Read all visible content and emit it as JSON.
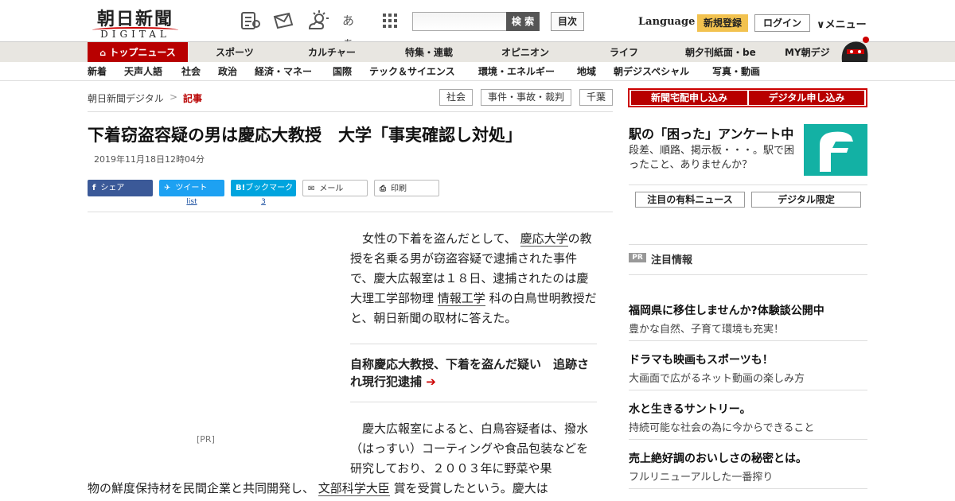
{
  "header": {
    "logo_kanji": "朝日新聞",
    "logo_sub": "DIGITAL",
    "search_button": "検 索",
    "search_placeholder": "",
    "toc_button": "目次",
    "language": "Language",
    "signup": "新規登録",
    "login": "ログイン",
    "menu": "メニュー",
    "icons": [
      "news-list-icon",
      "mail-icon",
      "weather-icon",
      "font-size-icon",
      "grid-menu-icon"
    ],
    "font_icon_text": "あぁ"
  },
  "nav_main": [
    "トップニュース",
    "スポーツ",
    "カルチャー",
    "特集・連載",
    "オピニオン",
    "ライフ",
    "朝夕刊紙面・be",
    "MY朝デジ"
  ],
  "nav_sub": [
    "新着",
    "天声人語",
    "社会",
    "政治",
    "経済・マネー",
    "国際",
    "テック＆サイエンス",
    "環境・エネルギー",
    "地域",
    "朝デジスペシャル",
    "写真・動画"
  ],
  "breadcrumb": {
    "home": "朝日新聞デジタル",
    "sep": ">",
    "current": "記事"
  },
  "tags": [
    "社会",
    "事件・事故・裁判",
    "千葉"
  ],
  "article": {
    "title": "下着窃盗容疑の男は慶応大教授　大学「事実確認し対処」",
    "date": "2019年11月18日12時04分",
    "share": {
      "facebook": "シェア",
      "twitter": "ツイート",
      "twitter_count": "list",
      "hatena": "ブックマーク",
      "hatena_count": "3",
      "mail": "メール",
      "print": "印刷"
    },
    "pr_label": "[PR]",
    "p1": {
      "a": "女性の下着を盗んだとして、",
      "k1": "慶応大学",
      "b": "の教授を名乗る男が窃盗容疑で逮捕された事件で、慶大広報室は１８日、逮捕されたのは慶大理工学部物理",
      "k2": "情報工学",
      "c": "科の白鳥世明教授だと、朝日新聞の取材に答えた。"
    },
    "related": "自称慶応大教授、下着を盗んだ疑い　追跡され現行犯逮捕",
    "p2": {
      "a": "慶大広報室によると、白鳥容疑者は、撥水（はっすい）コーティングや食品包装などを研究しており、２００３年に野菜や果",
      "b": "物の鮮度保持材を民間企業と共同開発し、",
      "k1": "文部科学大臣",
      "c": "賞を受賞したという。慶大は"
    }
  },
  "sidebar": {
    "btn_home_delivery": "新聞宅配申し込み",
    "btn_digital": "デジタル申し込み",
    "survey_title": "駅の「困った」アンケート中",
    "survey_desc": "段差、順路、掲示板・・・。駅で困ったこと、ありませんか？",
    "paid_news": "注目の有料ニュース",
    "digital_only": "デジタル限定",
    "pr_badge": "PR",
    "pr_heading": "注目情報",
    "ads": [
      {
        "title": "福岡県に移住しませんか?体験談公開中",
        "sub": "豊かな自然、子育て環境も充実！"
      },
      {
        "title": "ドラマも映画もスポーツも！",
        "sub": "大画面で広がるネット動画の楽しみ方"
      },
      {
        "title": "水と生きるサントリー。",
        "sub": "持続可能な社会の為に今からできること"
      },
      {
        "title": "売上絶好調のおいしさの秘密とは。",
        "sub": "フルリニューアルした一番搾り"
      }
    ]
  },
  "colors": {
    "brand_red": "#b80000",
    "signup_yellow": "#f2c24f",
    "survey_teal": "#13b1a4",
    "facebook": "#3b5998",
    "twitter": "#1da1f2",
    "hatena": "#00a4de"
  }
}
